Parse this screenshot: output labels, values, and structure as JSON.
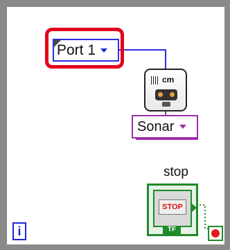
{
  "port_control": {
    "label": "Port 1"
  },
  "sensor": {
    "unit": "cm",
    "icon": "ultrasonic-sensor-icon"
  },
  "mode_ring": {
    "label": "Sonar"
  },
  "stop_control": {
    "label": "stop",
    "button_text": "STOP",
    "type_tag": "TF"
  },
  "loop": {
    "iteration_label": "i"
  },
  "colors": {
    "loop_border": "#8a8a8a",
    "highlight": "#e3001e",
    "int_wire": "#2d2de0",
    "enum_wire": "#9c2fa8",
    "boolean": "#1e8a2a",
    "stop_red": "#e31b1b"
  }
}
